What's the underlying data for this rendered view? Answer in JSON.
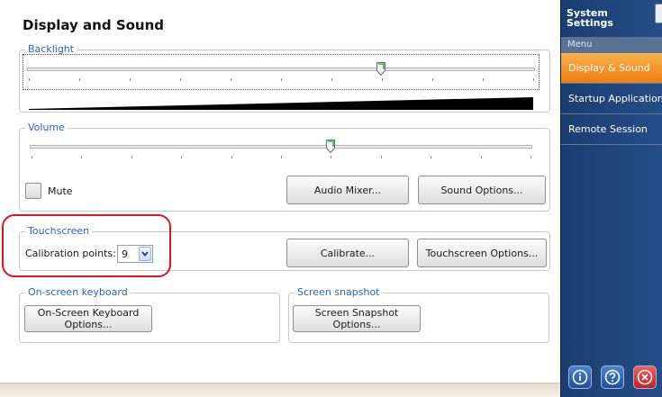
{
  "page": {
    "title": "Display and Sound"
  },
  "backlight": {
    "legend": "Backlight",
    "level": 0.7
  },
  "volume": {
    "legend": "Volume",
    "level": 0.6,
    "mute_label": "Mute",
    "mute_checked": false,
    "audio_mixer_label": "Audio Mixer...",
    "sound_options_label": "Sound Options..."
  },
  "touchscreen": {
    "legend": "Touchscreen",
    "calibration_label": "Calibration points:",
    "calibration_value": "9",
    "calibrate_label": "Calibrate...",
    "options_label": "Touchscreen Options..."
  },
  "keyboard": {
    "legend": "On-screen keyboard",
    "button_line1": "On-Screen Keyboard",
    "button_line2": "Options..."
  },
  "snapshot": {
    "legend": "Screen snapshot",
    "button_label": "Screen Snapshot Options..."
  },
  "sidebar": {
    "title_line1": "System",
    "title_line2": "Settings",
    "menu_label": "Menu",
    "items": [
      {
        "label": "Display & Sound",
        "active": true
      },
      {
        "label": "Startup Applications",
        "active": false
      },
      {
        "label": "Remote Session",
        "active": false
      }
    ]
  },
  "colors": {
    "accent": "#f0891d",
    "sidebar": "#1f4479",
    "highlight": "#d9171f",
    "legend_text": "#2b63b6"
  },
  "icons": {
    "info": "info-icon",
    "help": "help-icon",
    "close": "close-icon"
  }
}
